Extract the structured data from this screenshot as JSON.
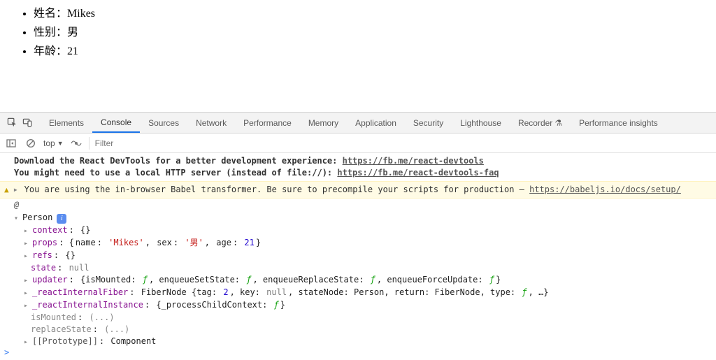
{
  "page": {
    "items": [
      {
        "label": "姓名",
        "value": "Mikes"
      },
      {
        "label": "性别",
        "value": "男"
      },
      {
        "label": "年龄",
        "value": "21"
      }
    ],
    "sep": "："
  },
  "tabs": {
    "elements": "Elements",
    "console": "Console",
    "sources": "Sources",
    "network": "Network",
    "performance": "Performance",
    "memory": "Memory",
    "application": "Application",
    "security": "Security",
    "lighthouse": "Lighthouse",
    "recorder": "Recorder",
    "perf_insights": "Performance insights"
  },
  "subbar": {
    "context": "top",
    "filter_placeholder": "Filter"
  },
  "msgs": {
    "react1_a": "Download the React DevTools for a better development experience: ",
    "react1_link": "https://fb.me/react-devtools",
    "react2_a": "You might need to use a local HTTP server (instead of file://): ",
    "react2_link": "https://fb.me/react-devtools-faq",
    "warn_a": "You are using the in-browser Babel transformer. Be sure to precompile your scripts for production – ",
    "warn_link": "https://babeljs.io/docs/setup/",
    "at": "@"
  },
  "obj": {
    "head": "Person",
    "context_k": "context",
    "context_v": "{}",
    "props_k": "props",
    "props_name_k": "name",
    "props_name_v": "'Mikes'",
    "props_sex_k": "sex",
    "props_sex_v": "'男'",
    "props_age_k": "age",
    "props_age_v": "21",
    "refs_k": "refs",
    "refs_v": "{}",
    "state_k": "state",
    "state_v": "null",
    "updater_k": "updater",
    "updater_v_pre": "{isMounted: ",
    "updater_v_mid1": ", enqueueSetState: ",
    "updater_v_mid2": ", enqueueReplaceState: ",
    "updater_v_mid3": ", enqueueForceUpdate: ",
    "updater_v_end": "}",
    "fiber_k": "_reactInternalFiber",
    "fiber_v_pre": "FiberNode {tag: ",
    "fiber_tag": "2",
    "fiber_mid1": ", key: ",
    "fiber_key": "null",
    "fiber_mid2": ", stateNode: Person, return: FiberNode, type: ",
    "fiber_end": ", …}",
    "inst_k": "_reactInternalInstance",
    "inst_v": "{_processChildContext: ",
    "inst_end": "}",
    "ism_k": "isMounted",
    "ism_v": "(...)",
    "rep_k": "replaceState",
    "rep_v": "(...)",
    "proto_k": "[[Prototype]]",
    "proto_v": "Component",
    "fn": "ƒ"
  },
  "prompt": ">"
}
